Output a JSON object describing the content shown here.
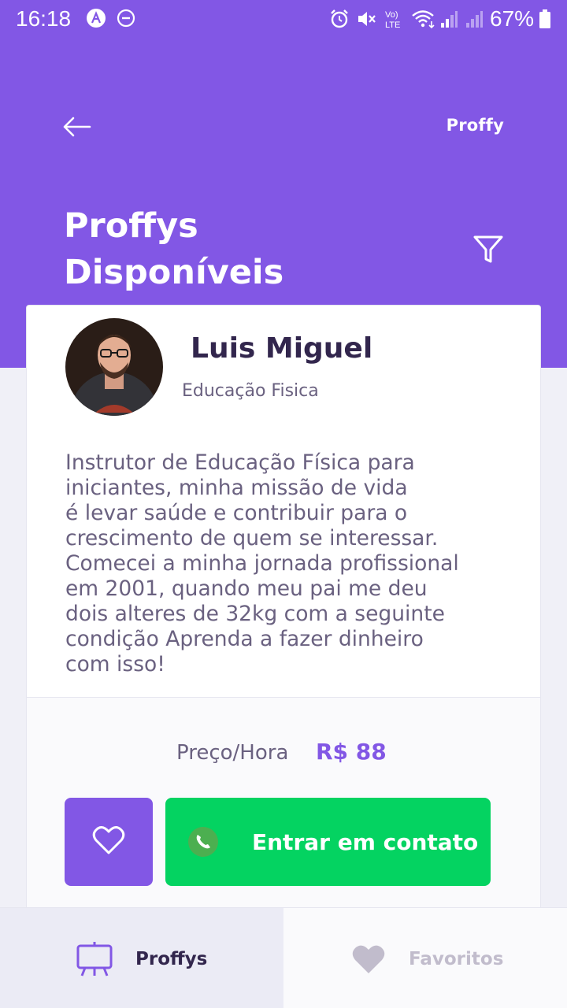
{
  "status_bar": {
    "time": "16:18",
    "battery": "67%"
  },
  "header": {
    "logo": "Proffy",
    "title_line1": "Proffys",
    "title_line2": "Disponíveis"
  },
  "teacher": {
    "name": "Luis Miguel",
    "subject": "Educação Fisica",
    "bio_lines": [
      "Instrutor de Educação Física para",
      "iniciantes, minha missão de vida",
      "é levar saúde e contribuir para o",
      "crescimento de quem se interessar.",
      "Comecei a minha jornada profissional",
      "em 2001, quando meu pai me deu",
      "dois alteres de 32kg com a seguinte",
      "condição Aprenda a fazer dinheiro",
      "com isso!"
    ],
    "price_label": "Preço/Hora",
    "price_value": "R$ 88",
    "contact_label": "Entrar em contato"
  },
  "tabs": [
    {
      "label": "Proffys",
      "icon": "easel-icon",
      "active": true
    },
    {
      "label": "Favoritos",
      "icon": "heart-icon",
      "active": false
    }
  ],
  "colors": {
    "primary": "#8257e5",
    "green": "#04d361",
    "title_dark": "#32264d",
    "text": "#6a6180",
    "background": "#f0f0f7"
  }
}
